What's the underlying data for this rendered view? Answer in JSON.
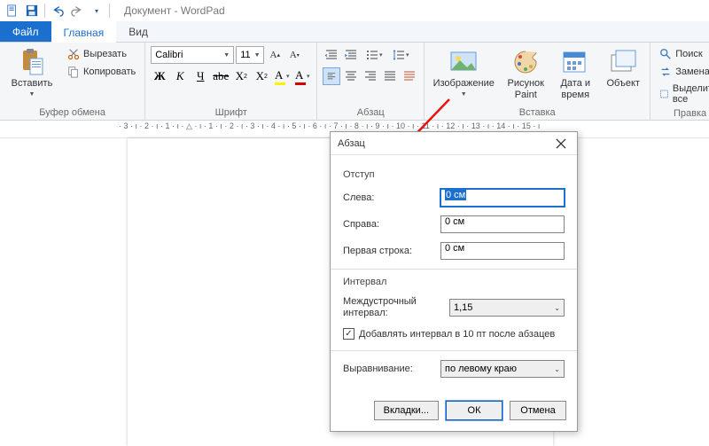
{
  "window": {
    "title": "Документ - WordPad"
  },
  "tabs": {
    "file": "Файл",
    "home": "Главная",
    "view": "Вид"
  },
  "groups": {
    "clipboard": {
      "title": "Буфер обмена",
      "paste": "Вставить",
      "cut": "Вырезать",
      "copy": "Копировать"
    },
    "font": {
      "title": "Шрифт",
      "family": "Calibri",
      "size": "11"
    },
    "paragraph": {
      "title": "Абзац"
    },
    "insert": {
      "title": "Вставка",
      "image": "Изображение",
      "paint": "Рисунок Paint",
      "datetime": "Дата и время",
      "object": "Объект"
    },
    "editing": {
      "title": "Правка",
      "find": "Поиск",
      "replace": "Замена",
      "selectall": "Выделить все"
    }
  },
  "ruler": "· 3 · ı · 2 · ı · 1 · ı · △ · ı · 1 · ı · 2 · ı · 3 · ı · 4 · ı · 5 · ı · 6 · ı · 7 · ı · 8 · ı · 9 · ı · 10 · ı · 11 · ı · 12 · ı · 13 · ı · 14 · ı · 15 · ı",
  "dialog": {
    "title": "Абзац",
    "indent_label": "Отступ",
    "left": {
      "label": "Слева:",
      "value": "0 см"
    },
    "right": {
      "label": "Справа:",
      "value": "0 см"
    },
    "firstline": {
      "label": "Первая строка:",
      "value": "0 см"
    },
    "interval_label": "Интервал",
    "linespacing_label": "Междустрочный интервал:",
    "linespacing_value": "1,15",
    "add_space_label": "Добавлять интервал в 10 пт после абзацев",
    "add_space_checked": true,
    "align_label": "Выравнивание:",
    "align_value": "по левому краю",
    "btn_tabs": "Вкладки...",
    "btn_ok": "ОК",
    "btn_cancel": "Отмена"
  }
}
